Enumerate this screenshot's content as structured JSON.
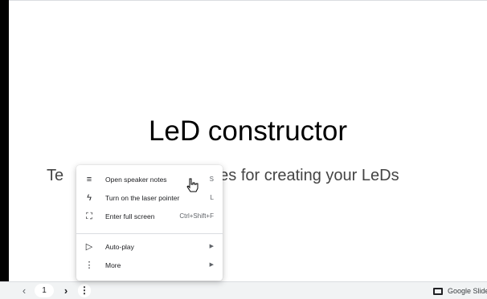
{
  "slide": {
    "title": "LeD constructor",
    "subtitle": "Templates and guidelines for creating your LeDs",
    "subtitle_left": "Te",
    "subtitle_right": "lines for creating your LeDs"
  },
  "bottom_bar": {
    "prev_icon": "‹",
    "page_number": "1",
    "next_icon": "›",
    "more_icon": "⋮",
    "brand_label": "Google Slides"
  },
  "menu": {
    "items": [
      {
        "icon": "speaker-notes-icon",
        "glyph": "≡",
        "label": "Open speaker notes",
        "shortcut": "S"
      },
      {
        "icon": "laser-pointer-icon",
        "glyph": "ϟ",
        "label": "Turn on the laser pointer",
        "shortcut": "L"
      },
      {
        "icon": "fullscreen-icon",
        "glyph": "⛶",
        "label": "Enter full screen",
        "shortcut": "Ctrl+Shift+F"
      },
      {
        "icon": "play-icon",
        "glyph": "▷",
        "label": "Auto-play",
        "arrow": "▶"
      },
      {
        "icon": "more-vert-icon",
        "glyph": "⋮",
        "label": "More",
        "arrow": "▶"
      }
    ]
  },
  "colors": {
    "accent": "#202124",
    "bar_bg": "#f1f3f4",
    "divider": "#dadce0"
  }
}
